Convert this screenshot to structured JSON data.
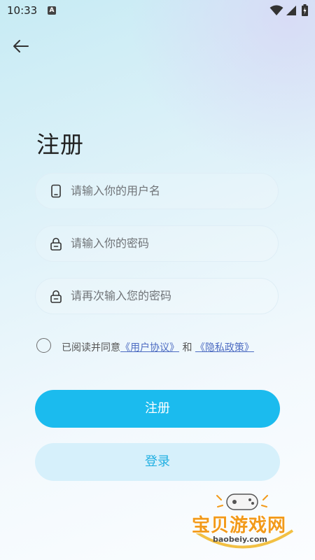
{
  "status_bar": {
    "time": "10:33",
    "notification_badge": "A"
  },
  "page": {
    "title": "注册"
  },
  "form": {
    "username_placeholder": "请输入你的用户名",
    "password_placeholder": "请输入你的密码",
    "confirm_placeholder": "请再次输入您的密码"
  },
  "agreement": {
    "prefix": "已阅读并同意",
    "user_agreement": "《用户协议》",
    "conjunction": "和",
    "privacy_policy": "《隐私政策》"
  },
  "buttons": {
    "register": "注册",
    "login": "登录"
  },
  "watermark": {
    "name": "宝贝游戏网",
    "url": "baobeiy.com"
  },
  "colors": {
    "primary": "#1bbbee",
    "secondary_bg": "#d6f0fb",
    "link": "#4d6cc2"
  }
}
